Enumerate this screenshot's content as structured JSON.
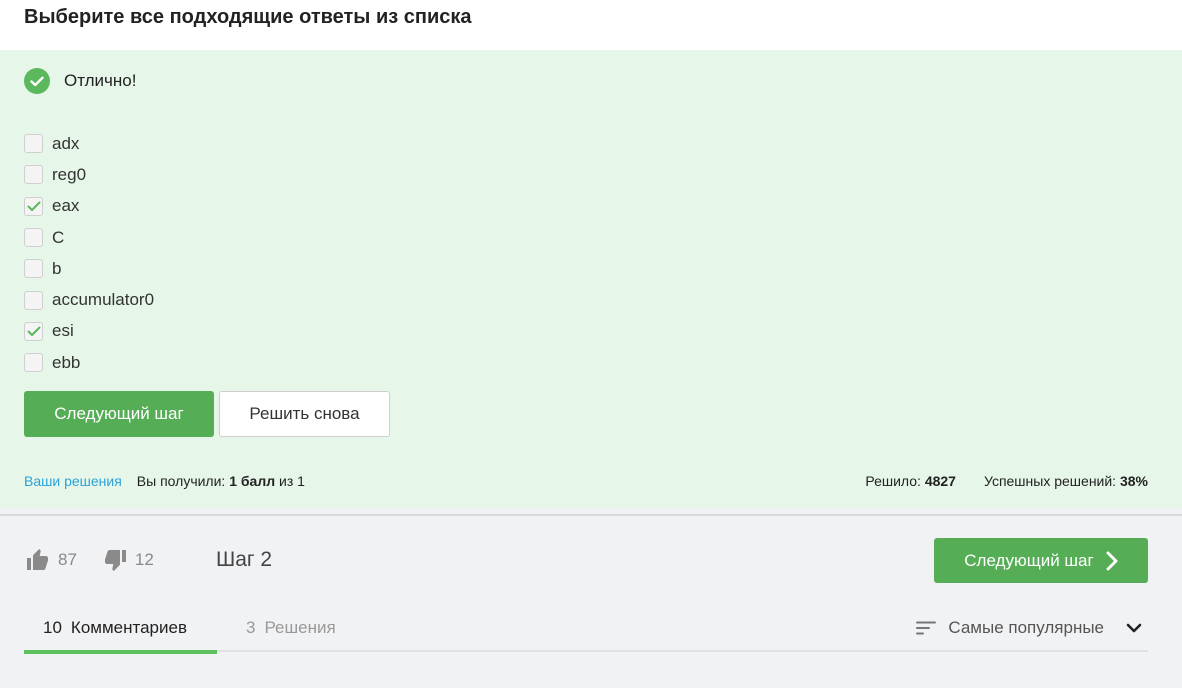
{
  "question": {
    "title": "Выберите все подходящие ответы из списка"
  },
  "feedback": {
    "text": "Отлично!"
  },
  "options": [
    {
      "label": "adx",
      "checked": false
    },
    {
      "label": "reg0",
      "checked": false
    },
    {
      "label": "eax",
      "checked": true
    },
    {
      "label": "C",
      "checked": false
    },
    {
      "label": "b",
      "checked": false
    },
    {
      "label": "accumulator0",
      "checked": false
    },
    {
      "label": "esi",
      "checked": true
    },
    {
      "label": "ebb",
      "checked": false
    }
  ],
  "actions": {
    "next_label": "Следующий шаг",
    "retry_label": "Решить снова"
  },
  "stats": {
    "solutions_link": "Ваши решения",
    "received_prefix": "Вы получили:",
    "score": "1 балл",
    "score_suffix": "из 1",
    "solved_label": "Решило:",
    "solved_count": "4827",
    "success_label": "Успешных решений:",
    "success_rate": "38%"
  },
  "footer": {
    "likes": "87",
    "dislikes": "12",
    "step_label": "Шаг 2",
    "next_label": "Следующий шаг"
  },
  "tabs": [
    {
      "count": "10",
      "label": "Комментариев",
      "active": true
    },
    {
      "count": "3",
      "label": "Решения",
      "active": false
    }
  ],
  "sort": {
    "label": "Самые популярные"
  },
  "colors": {
    "accent": "#55ad55",
    "success_bg": "#e6f6e9",
    "link": "#2ba3d9"
  },
  "icons": {
    "success": "check-circle-icon",
    "like": "thumbs-up-icon",
    "dislike": "thumbs-down-icon",
    "next": "chevron-right-icon",
    "sort": "sort-lines-icon",
    "dropdown": "chevron-down-icon"
  }
}
